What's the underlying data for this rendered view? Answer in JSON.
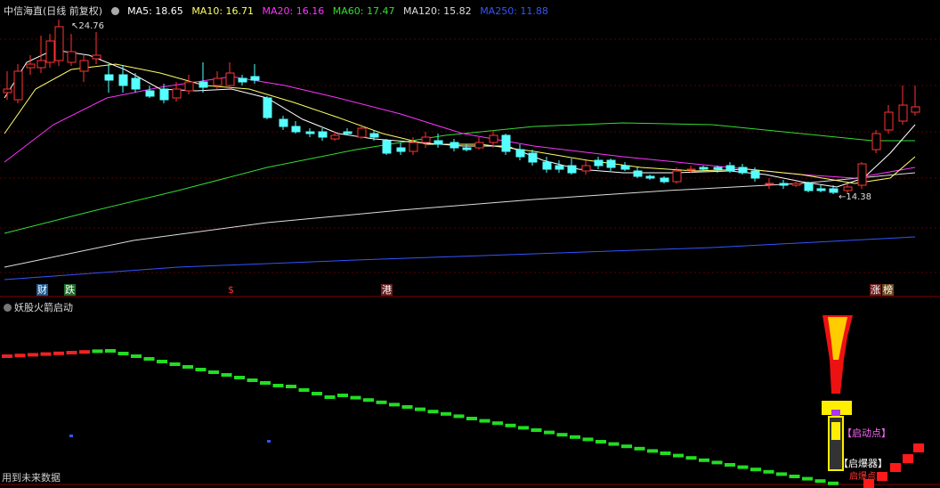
{
  "header": {
    "stock_title": "中信海直(日线 前复权)",
    "ma_labels": [
      {
        "text": "MA5: 18.65",
        "color": "#ffffff"
      },
      {
        "text": "MA10: 16.71",
        "color": "#ffff66"
      },
      {
        "text": "MA20: 16.16",
        "color": "#ff33ff"
      },
      {
        "text": "MA60: 17.47",
        "color": "#33dd33"
      },
      {
        "text": "MA120: 15.82",
        "color": "#dddddd"
      },
      {
        "text": "MA250: 11.88",
        "color": "#3355ff"
      }
    ]
  },
  "price_marks": {
    "high": "24.76",
    "low": "14.38"
  },
  "event_badges": [
    {
      "text": "财",
      "bg": "#1e5a8c",
      "color": "#ffffff"
    },
    {
      "text": "跌",
      "bg": "#1e6b2a",
      "color": "#ffffff"
    },
    {
      "text": "$",
      "bg": "#000000",
      "color": "#ff3333"
    },
    {
      "text": "港",
      "bg": "#6b1e1e",
      "color": "#ffffff"
    },
    {
      "text": "涨",
      "bg": "#6b1e1e",
      "color": "#ffffff"
    },
    {
      "text": "榜",
      "bg": "#6b4a1e",
      "color": "#ffffff"
    }
  ],
  "indicator": {
    "title": "妖股火箭启动",
    "label_start": "【启动点】",
    "label_explode": "【启爆器】",
    "label_top": "启爆点"
  },
  "footer": {
    "note": "用到未来数据"
  },
  "colors": {
    "up": "#ff3333",
    "down": "#55ffff",
    "ma5": "#ffffff",
    "ma10": "#ffff66",
    "ma20": "#ff33ff",
    "ma60": "#33dd33",
    "ma120": "#dddddd",
    "ma250": "#3355ff"
  }
}
